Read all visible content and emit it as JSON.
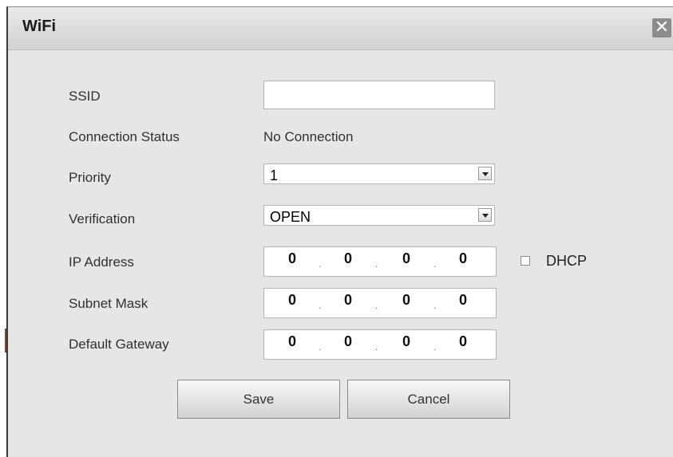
{
  "window": {
    "title": "WiFi",
    "close_glyph": "✕",
    "close_icon": "close-icon"
  },
  "form": {
    "ssid": {
      "label": "SSID",
      "value": "",
      "placeholder": ""
    },
    "connection_status": {
      "label": "Connection Status",
      "value": "No Connection"
    },
    "priority": {
      "label": "Priority",
      "value": "1",
      "arrow_icon": "chevron-down-icon"
    },
    "verification": {
      "label": "Verification",
      "value": "OPEN",
      "arrow_icon": "chevron-down-icon"
    },
    "ip_address": {
      "label": "IP Address",
      "octets": [
        "0",
        "0",
        "0",
        "0"
      ]
    },
    "subnet_mask": {
      "label": "Subnet Mask",
      "octets": [
        "0",
        "0",
        "0",
        "0"
      ]
    },
    "default_gateway": {
      "label": "Default Gateway",
      "octets": [
        "0",
        "0",
        "0",
        "0"
      ]
    },
    "ip_separator": ".",
    "dhcp": {
      "label": "DHCP",
      "checked": false
    }
  },
  "buttons": {
    "save": "Save",
    "cancel": "Cancel"
  }
}
